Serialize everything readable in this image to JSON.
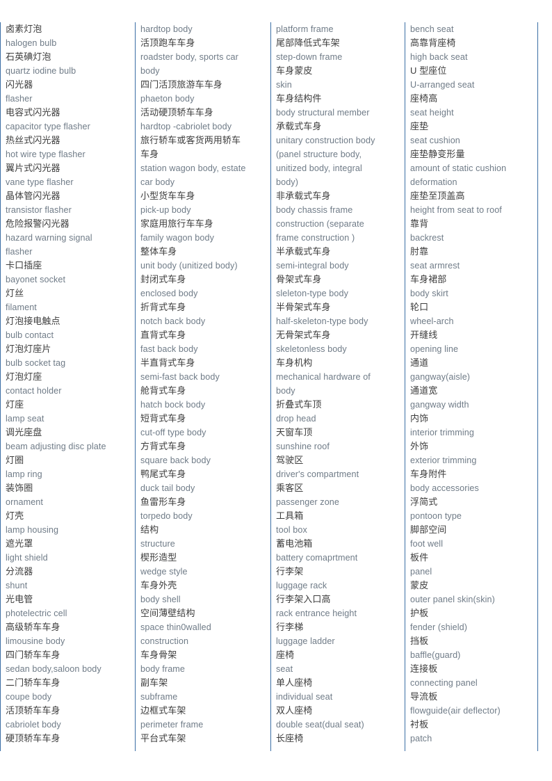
{
  "document": {
    "type": "bilingual-glossary",
    "subject": "Automotive lighting and body terminology",
    "language_pair": "Chinese-English",
    "column_count": 4,
    "colors": {
      "column_rule": "#3a6ea5",
      "chinese_text": "#3d3d3d",
      "english_text": "#6f7b87",
      "background": "#ffffff"
    }
  },
  "columns": [
    {
      "id": "column-1",
      "lines": [
        {
          "lang": "zh",
          "text": "卤素灯泡"
        },
        {
          "lang": "en",
          "text": "halogen bulb"
        },
        {
          "lang": "zh",
          "text": "石英碘灯泡"
        },
        {
          "lang": "en",
          "text": "quartz iodine bulb"
        },
        {
          "lang": "zh",
          "text": "闪光器"
        },
        {
          "lang": "en",
          "text": "flasher"
        },
        {
          "lang": "zh",
          "text": "电容式闪光器"
        },
        {
          "lang": "en",
          "text": "capacitor type flasher"
        },
        {
          "lang": "zh",
          "text": "热丝式闪光器"
        },
        {
          "lang": "en",
          "text": "hot wire type flasher"
        },
        {
          "lang": "zh",
          "text": "翼片式闪光器"
        },
        {
          "lang": "en",
          "text": "vane type flasher"
        },
        {
          "lang": "zh",
          "text": "晶体管闪光器"
        },
        {
          "lang": "en",
          "text": "transistor flasher"
        },
        {
          "lang": "zh",
          "text": "危险报警闪光器"
        },
        {
          "lang": "en",
          "text": "hazard warning signal"
        },
        {
          "lang": "en",
          "text": "flasher"
        },
        {
          "lang": "zh",
          "text": "卡口插座"
        },
        {
          "lang": "en",
          "text": "bayonet socket"
        },
        {
          "lang": "zh",
          "text": "灯丝"
        },
        {
          "lang": "en",
          "text": "filament"
        },
        {
          "lang": "zh",
          "text": "灯泡接电触点"
        },
        {
          "lang": "en",
          "text": "bulb contact"
        },
        {
          "lang": "zh",
          "text": "灯泡灯座片"
        },
        {
          "lang": "en",
          "text": "bulb socket tag"
        },
        {
          "lang": "zh",
          "text": "灯泡灯座"
        },
        {
          "lang": "en",
          "text": "contact holder"
        },
        {
          "lang": "zh",
          "text": "灯座"
        },
        {
          "lang": "en",
          "text": "lamp seat"
        },
        {
          "lang": "zh",
          "text": "调光座盘"
        },
        {
          "lang": "en",
          "text": "beam adjusting disc plate"
        },
        {
          "lang": "zh",
          "text": "灯圈"
        },
        {
          "lang": "en",
          "text": "lamp ring"
        },
        {
          "lang": "zh",
          "text": "装饰圈"
        },
        {
          "lang": "en",
          "text": "ornament"
        },
        {
          "lang": "zh",
          "text": "灯壳"
        },
        {
          "lang": "en",
          "text": "lamp housing"
        },
        {
          "lang": "zh",
          "text": "遮光罩"
        },
        {
          "lang": "en",
          "text": "light shield"
        },
        {
          "lang": "zh",
          "text": "分流器"
        },
        {
          "lang": "en",
          "text": "shunt"
        },
        {
          "lang": "zh",
          "text": "光电管"
        },
        {
          "lang": "en",
          "text": "photelectric cell"
        },
        {
          "lang": "zh",
          "text": "高级轿车车身"
        },
        {
          "lang": "en",
          "text": "limousine body"
        },
        {
          "lang": "zh",
          "text": "四门轿车车身"
        },
        {
          "lang": "en",
          "text": "sedan body,saloon body"
        },
        {
          "lang": "zh",
          "text": "二门轿车车身"
        },
        {
          "lang": "en",
          "text": "coupe body"
        },
        {
          "lang": "zh",
          "text": "活顶轿车车身"
        },
        {
          "lang": "en",
          "text": "cabriolet body"
        },
        {
          "lang": "zh",
          "text": "硬顶轿车车身"
        }
      ]
    },
    {
      "id": "column-2",
      "lines": [
        {
          "lang": "en",
          "text": "hardtop body"
        },
        {
          "lang": "zh",
          "text": "活顶跑车车身"
        },
        {
          "lang": "en",
          "text": "roadster body, sports car"
        },
        {
          "lang": "en",
          "text": "body"
        },
        {
          "lang": "zh",
          "text": "四门活顶旅游车车身"
        },
        {
          "lang": "en",
          "text": "phaeton body"
        },
        {
          "lang": "zh",
          "text": "活动硬顶轿车车身"
        },
        {
          "lang": "en",
          "text": "hardtop -cabriolet body"
        },
        {
          "lang": "zh",
          "text": "旅行轿车或客货两用轿车"
        },
        {
          "lang": "zh",
          "text": "车身"
        },
        {
          "lang": "en",
          "text": "station wagon body, estate"
        },
        {
          "lang": "en",
          "text": "car body"
        },
        {
          "lang": "zh",
          "text": "小型货车车身"
        },
        {
          "lang": "en",
          "text": "pick-up body"
        },
        {
          "lang": "zh",
          "text": "家庭用旅行车车身"
        },
        {
          "lang": "en",
          "text": "family wagon body"
        },
        {
          "lang": "zh",
          "text": "整体车身"
        },
        {
          "lang": "en",
          "text": "unit body (unitized body)"
        },
        {
          "lang": "zh",
          "text": "封闭式车身"
        },
        {
          "lang": "en",
          "text": "enclosed body"
        },
        {
          "lang": "zh",
          "text": "折背式车身"
        },
        {
          "lang": "en",
          "text": "notch back body"
        },
        {
          "lang": "zh",
          "text": "直背式车身"
        },
        {
          "lang": "en",
          "text": "fast back body"
        },
        {
          "lang": "zh",
          "text": "半直背式车身"
        },
        {
          "lang": "en",
          "text": "semi-fast back body"
        },
        {
          "lang": "zh",
          "text": "舱背式车身"
        },
        {
          "lang": "en",
          "text": "hatch bock body"
        },
        {
          "lang": "zh",
          "text": "短背式车身"
        },
        {
          "lang": "en",
          "text": "cut-off type body"
        },
        {
          "lang": "zh",
          "text": "方背式车身"
        },
        {
          "lang": "en",
          "text": "square back body"
        },
        {
          "lang": "zh",
          "text": "鸭尾式车身"
        },
        {
          "lang": "en",
          "text": "duck tail body"
        },
        {
          "lang": "zh",
          "text": "鱼雷形车身"
        },
        {
          "lang": "en",
          "text": "torpedo body"
        },
        {
          "lang": "zh",
          "text": "结构"
        },
        {
          "lang": "en",
          "text": "structure"
        },
        {
          "lang": "zh",
          "text": "楔形造型"
        },
        {
          "lang": "en",
          "text": "wedge style"
        },
        {
          "lang": "zh",
          "text": "车身外壳"
        },
        {
          "lang": "en",
          "text": "body shell"
        },
        {
          "lang": "zh",
          "text": "空间薄壁结构"
        },
        {
          "lang": "en",
          "text": "space thin0walled"
        },
        {
          "lang": "en",
          "text": "construction"
        },
        {
          "lang": "zh",
          "text": "车身骨架"
        },
        {
          "lang": "en",
          "text": "body frame"
        },
        {
          "lang": "zh",
          "text": "副车架"
        },
        {
          "lang": "en",
          "text": "subframe"
        },
        {
          "lang": "zh",
          "text": "边框式车架"
        },
        {
          "lang": "en",
          "text": "perimeter frame"
        },
        {
          "lang": "zh",
          "text": "平台式车架"
        }
      ]
    },
    {
      "id": "column-3",
      "lines": [
        {
          "lang": "en",
          "text": "platform frame"
        },
        {
          "lang": "zh",
          "text": "尾部降低式车架"
        },
        {
          "lang": "en",
          "text": "step-down frame"
        },
        {
          "lang": "zh",
          "text": "车身蒙皮"
        },
        {
          "lang": "en",
          "text": "skin"
        },
        {
          "lang": "zh",
          "text": "车身结构件"
        },
        {
          "lang": "en",
          "text": "body structural member"
        },
        {
          "lang": "zh",
          "text": "承载式车身"
        },
        {
          "lang": "en",
          "text": "unitary construction body"
        },
        {
          "lang": "en",
          "text": "(panel structure body,"
        },
        {
          "lang": "en",
          "text": "unitized body, integral"
        },
        {
          "lang": "en",
          "text": "body)"
        },
        {
          "lang": "zh",
          "text": "非承载式车身"
        },
        {
          "lang": "en",
          "text": "body chassis frame"
        },
        {
          "lang": "en",
          "text": "construction (separate"
        },
        {
          "lang": "en",
          "text": "frame construction )"
        },
        {
          "lang": "zh",
          "text": "半承载式车身"
        },
        {
          "lang": "en",
          "text": "semi-integral body"
        },
        {
          "lang": "zh",
          "text": "骨架式车身"
        },
        {
          "lang": "en",
          "text": "sleleton-type body"
        },
        {
          "lang": "zh",
          "text": "半骨架式车身"
        },
        {
          "lang": "en",
          "text": "half-skeleton-type body"
        },
        {
          "lang": "zh",
          "text": "无骨架式车身"
        },
        {
          "lang": "en",
          "text": "skeletonless body"
        },
        {
          "lang": "zh",
          "text": "车身机构"
        },
        {
          "lang": "en",
          "text": "mechanical hardware of"
        },
        {
          "lang": "en",
          "text": "body"
        },
        {
          "lang": "zh",
          "text": "折叠式车顶"
        },
        {
          "lang": "en",
          "text": "drop head"
        },
        {
          "lang": "zh",
          "text": "天窗车顶"
        },
        {
          "lang": "en",
          "text": "sunshine roof"
        },
        {
          "lang": "zh",
          "text": "驾驶区"
        },
        {
          "lang": "en",
          "text": "driver's compartment"
        },
        {
          "lang": "zh",
          "text": "乘客区"
        },
        {
          "lang": "en",
          "text": "passenger zone"
        },
        {
          "lang": "zh",
          "text": "工具箱"
        },
        {
          "lang": "en",
          "text": "tool box"
        },
        {
          "lang": "zh",
          "text": "蓄电池箱"
        },
        {
          "lang": "en",
          "text": "battery comaprtment"
        },
        {
          "lang": "zh",
          "text": "行李架"
        },
        {
          "lang": "en",
          "text": "luggage rack"
        },
        {
          "lang": "zh",
          "text": "行李架入口高"
        },
        {
          "lang": "en",
          "text": "rack entrance height"
        },
        {
          "lang": "zh",
          "text": "行李梯"
        },
        {
          "lang": "en",
          "text": "luggage ladder"
        },
        {
          "lang": "zh",
          "text": "座椅"
        },
        {
          "lang": "en",
          "text": "seat"
        },
        {
          "lang": "zh",
          "text": "单人座椅"
        },
        {
          "lang": "en",
          "text": "individual seat"
        },
        {
          "lang": "zh",
          "text": "双人座椅"
        },
        {
          "lang": "en",
          "text": "double seat(dual seat)"
        },
        {
          "lang": "zh",
          "text": "长座椅"
        }
      ]
    },
    {
      "id": "column-4",
      "lines": [
        {
          "lang": "en",
          "text": "bench seat"
        },
        {
          "lang": "zh",
          "text": "高靠背座椅"
        },
        {
          "lang": "en",
          "text": "high back seat"
        },
        {
          "lang": "zh",
          "text": "U 型座位"
        },
        {
          "lang": "en",
          "text": "U-arranged seat"
        },
        {
          "lang": "zh",
          "text": "座椅高"
        },
        {
          "lang": "en",
          "text": "seat height"
        },
        {
          "lang": "zh",
          "text": "座垫"
        },
        {
          "lang": "en",
          "text": "seat cushion"
        },
        {
          "lang": "zh",
          "text": "座垫静变形量"
        },
        {
          "lang": "en",
          "text": "amount of static cushion"
        },
        {
          "lang": "en",
          "text": "deformation"
        },
        {
          "lang": "zh",
          "text": "座垫至顶盖高"
        },
        {
          "lang": "en",
          "text": "height from seat to roof"
        },
        {
          "lang": "zh",
          "text": "靠背"
        },
        {
          "lang": "en",
          "text": "backrest"
        },
        {
          "lang": "zh",
          "text": "肘靠"
        },
        {
          "lang": "en",
          "text": "seat armrest"
        },
        {
          "lang": "zh",
          "text": "车身裙部"
        },
        {
          "lang": "en",
          "text": "body skirt"
        },
        {
          "lang": "zh",
          "text": "轮口"
        },
        {
          "lang": "en",
          "text": "wheel-arch"
        },
        {
          "lang": "zh",
          "text": "开缝线"
        },
        {
          "lang": "en",
          "text": "opening line"
        },
        {
          "lang": "zh",
          "text": "通道"
        },
        {
          "lang": "en",
          "text": "gangway(aisle)"
        },
        {
          "lang": "zh",
          "text": "通道宽"
        },
        {
          "lang": "en",
          "text": "gangway width"
        },
        {
          "lang": "zh",
          "text": "内饰"
        },
        {
          "lang": "en",
          "text": "interior trimming"
        },
        {
          "lang": "zh",
          "text": "外饰"
        },
        {
          "lang": "en",
          "text": "exterior trimming"
        },
        {
          "lang": "zh",
          "text": "车身附件"
        },
        {
          "lang": "en",
          "text": "body accessories"
        },
        {
          "lang": "zh",
          "text": "浮简式"
        },
        {
          "lang": "en",
          "text": "pontoon type"
        },
        {
          "lang": "zh",
          "text": "脚部空间"
        },
        {
          "lang": "en",
          "text": "foot well"
        },
        {
          "lang": "zh",
          "text": "板件"
        },
        {
          "lang": "en",
          "text": "panel"
        },
        {
          "lang": "zh",
          "text": "蒙皮"
        },
        {
          "lang": "en",
          "text": "outer panel skin(skin)"
        },
        {
          "lang": "zh",
          "text": "护板"
        },
        {
          "lang": "en",
          "text": "fender (shield)"
        },
        {
          "lang": "zh",
          "text": "挡板"
        },
        {
          "lang": "en",
          "text": "baffle(guard)"
        },
        {
          "lang": "zh",
          "text": "连接板"
        },
        {
          "lang": "en",
          "text": "connecting panel"
        },
        {
          "lang": "zh",
          "text": "导流板"
        },
        {
          "lang": "en",
          "text": "flowguide(air deflector)"
        },
        {
          "lang": "zh",
          "text": "衬板"
        },
        {
          "lang": "en",
          "text": "patch"
        }
      ]
    }
  ]
}
